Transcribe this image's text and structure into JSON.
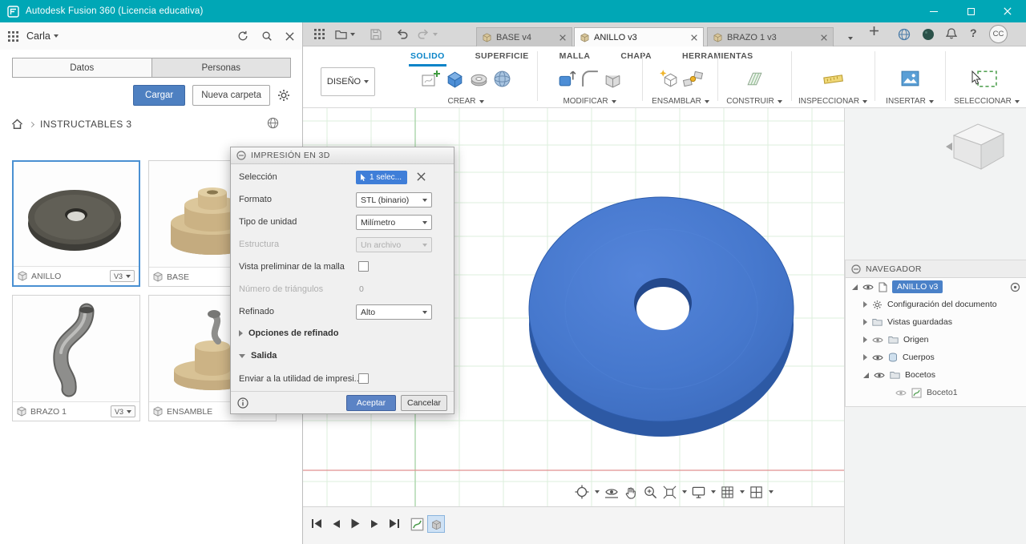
{
  "titlebar": {
    "title": "Autodesk Fusion 360 (Licencia educativa)"
  },
  "data_panel": {
    "user_name": "Carla",
    "tabs": [
      {
        "label": "Datos"
      },
      {
        "label": "Personas"
      }
    ],
    "upload_button": "Cargar",
    "new_folder_button": "Nueva carpeta",
    "breadcrumb": "INSTRUCTABLES 3",
    "cards": [
      {
        "name": "ANILLO",
        "version": "V3"
      },
      {
        "name": "BASE"
      },
      {
        "name": "BRAZO 1",
        "version": "V3"
      },
      {
        "name": "ENSAMBLE"
      }
    ]
  },
  "tabbar": {
    "tabs": [
      {
        "label": "BASE v4"
      },
      {
        "label": "ANILLO v3"
      },
      {
        "label": "BRAZO 1 v3"
      }
    ],
    "avatar": "CC"
  },
  "ribbon": {
    "design_button": "DISEÑO",
    "context_tabs": [
      {
        "label": "SOLIDO"
      },
      {
        "label": "SUPERFICIE"
      },
      {
        "label": "MALLA"
      },
      {
        "label": "CHAPA"
      },
      {
        "label": "HERRAMIENTAS"
      }
    ],
    "groups": [
      {
        "label": "CREAR"
      },
      {
        "label": "MODIFICAR"
      },
      {
        "label": "ENSAMBLAR"
      },
      {
        "label": "CONSTRUIR"
      },
      {
        "label": "INSPECCIONAR"
      },
      {
        "label": "INSERTAR"
      },
      {
        "label": "SELECCIONAR"
      }
    ]
  },
  "dialog": {
    "title": "IMPRESIÓN EN 3D",
    "rows": {
      "seleccion": {
        "label": "Selección",
        "value": "1 selec..."
      },
      "formato": {
        "label": "Formato",
        "value": "STL (binario)"
      },
      "unidad": {
        "label": "Tipo de unidad",
        "value": "Milímetro"
      },
      "estructura": {
        "label": "Estructura",
        "value": "Un archivo"
      },
      "vista_malla": {
        "label": "Vista preliminar de la malla"
      },
      "triangulos": {
        "label": "Número de triángulos",
        "value": "0"
      },
      "refinado": {
        "label": "Refinado",
        "value": "Alto"
      },
      "opciones": {
        "label": "Opciones de refinado"
      },
      "salida": {
        "label": "Salida"
      },
      "enviar": {
        "label": "Enviar a la utilidad de impresi..."
      }
    },
    "ok_button": "Aceptar",
    "cancel_button": "Cancelar"
  },
  "navigator": {
    "title": "NAVEGADOR",
    "root": "ANILLO v3",
    "items": [
      {
        "label": "Configuración del documento"
      },
      {
        "label": "Vistas guardadas"
      },
      {
        "label": "Origen"
      },
      {
        "label": "Cuerpos"
      },
      {
        "label": "Bocetos"
      },
      {
        "label": "Boceto1"
      }
    ]
  },
  "colors": {
    "titlebar_teal": "#00a7b6",
    "accent_blue": "#4e80c1",
    "selection_blue": "#3f7ed8",
    "ribbon_active_tab": "#0a84c8",
    "model_blue": "#4577cb"
  }
}
